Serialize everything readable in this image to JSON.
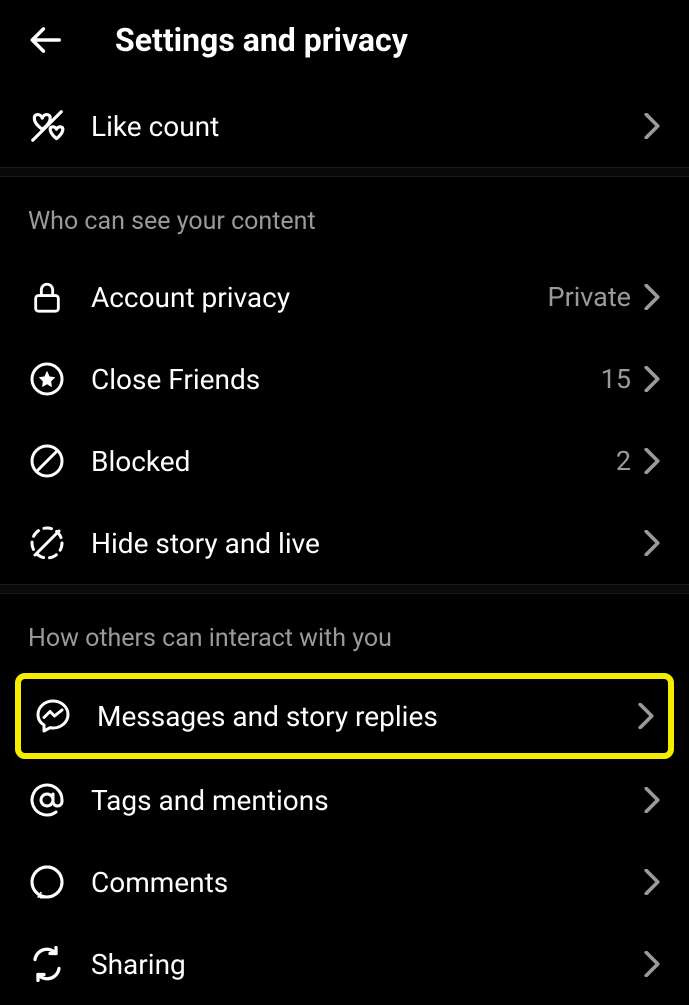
{
  "header": {
    "title": "Settings and privacy"
  },
  "top_items": [
    {
      "label": "Like count",
      "value": ""
    }
  ],
  "sections": [
    {
      "title": "Who can see your content",
      "items": [
        {
          "label": "Account privacy",
          "value": "Private"
        },
        {
          "label": "Close Friends",
          "value": "15"
        },
        {
          "label": "Blocked",
          "value": "2"
        },
        {
          "label": "Hide story and live",
          "value": ""
        }
      ]
    },
    {
      "title": "How others can interact with you",
      "items": [
        {
          "label": "Messages and story replies",
          "value": ""
        },
        {
          "label": "Tags and mentions",
          "value": ""
        },
        {
          "label": "Comments",
          "value": ""
        },
        {
          "label": "Sharing",
          "value": ""
        }
      ]
    }
  ]
}
